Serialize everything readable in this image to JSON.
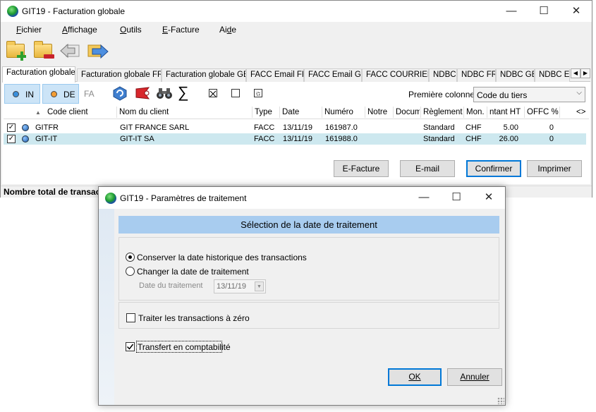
{
  "main_window": {
    "title": "GIT19 - Facturation globale",
    "controls": {
      "minimize": "—",
      "maximize": "☐",
      "close": "✕"
    },
    "menu": [
      {
        "label": "Fichier",
        "accel": "F",
        "rest": "ichier"
      },
      {
        "label": "Affichage",
        "accel": "A",
        "rest": "ffichage"
      },
      {
        "label": "Outils",
        "accel": "O",
        "rest": "utils"
      },
      {
        "label": "E-Facture",
        "accel": "E",
        "rest": "-Facture"
      },
      {
        "label": "Aide",
        "pre": "Ai",
        "accel": "d",
        "rest": "e"
      }
    ],
    "toolbar_icons": [
      "new-folder-icon",
      "delete-folder-icon",
      "back-arrow-icon",
      "forward-arrow-icon"
    ],
    "tabs": [
      "Facturation globale",
      "Facturation globale FR",
      "Facturation globale GB",
      "FACC Email FR",
      "FACC Email GB",
      "FACC COURRIER",
      "NDBC",
      "NDBC FR",
      "NDBC GB",
      "NDBC Em"
    ],
    "tab_scroll": {
      "left": "◀",
      "right": "▶"
    },
    "filters": {
      "in": "IN",
      "de": "DE",
      "fa": "FA",
      "in_dot_color": "#3a8fdc",
      "de_dot_color": "#f39c33"
    },
    "first_column_label": "Première colonne",
    "first_column_value": "Code du tiers",
    "columns": [
      "",
      "Code client",
      "Nom du client",
      "Type",
      "Date",
      "Numéro",
      "Notre",
      "Docum",
      "Règlement",
      "Mon.",
      "ntant HT",
      "OFFC %",
      "<>"
    ],
    "sort_indicator": "▲",
    "rows": [
      {
        "checked": "✓",
        "code": "GITFR",
        "nom": "GIT FRANCE SARL",
        "type": "FACC",
        "date": "13/11/19",
        "numero": "161987.0",
        "reglement": "Standard",
        "monnaie": "CHF",
        "montant": "5.00",
        "offc": "0"
      },
      {
        "checked": "✓",
        "code": "GIT-IT",
        "nom": "GIT-IT SA",
        "type": "FACC",
        "date": "13/11/19",
        "numero": "161988.0",
        "reglement": "Standard",
        "monnaie": "CHF",
        "montant": "26.00",
        "offc": "0"
      }
    ],
    "buttons": {
      "efacture": "E-Facture",
      "email": "E-mail",
      "confirmer": "Confirmer",
      "imprimer": "Imprimer"
    },
    "status_text": "Nombre total de transactio"
  },
  "dialog": {
    "title": "GIT19 - Paramètres de traitement",
    "section_title": "Sélection de la date de traitement",
    "option_keep": "Conserver la date historique des transactions",
    "option_change": "Changer la date de traitement",
    "date_label": "Date du traitement",
    "date_value": "13/11/19",
    "zero_label": "Traiter les transactions à zéro",
    "transfer_label": "Transfert en comptabilité",
    "ok_label": "OK",
    "cancel_label": "Annuler",
    "accent_color": "#a8ccef"
  }
}
